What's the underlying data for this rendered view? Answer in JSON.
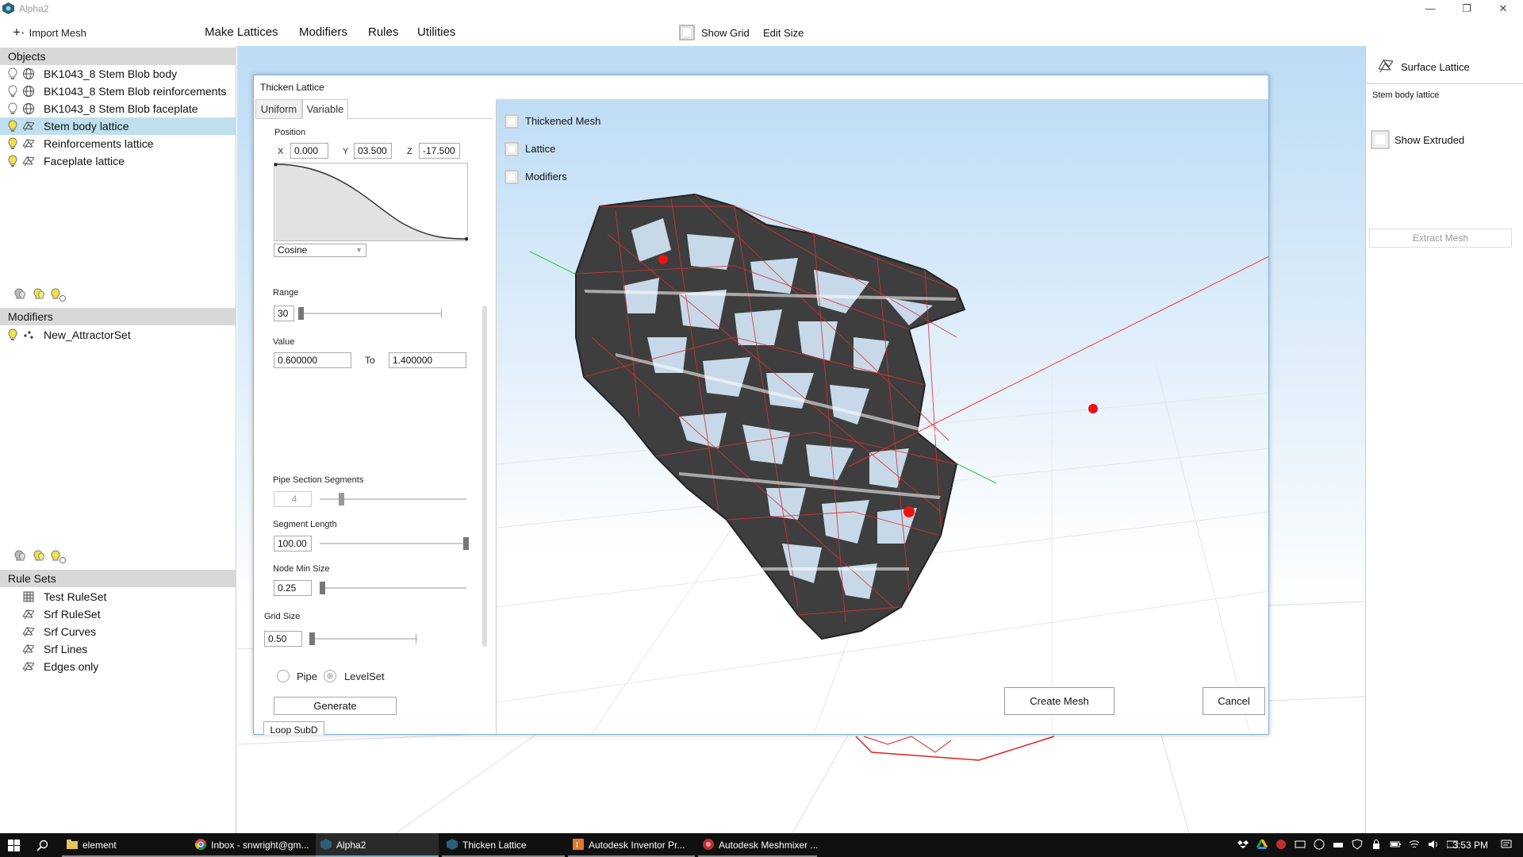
{
  "window": {
    "title": "Alpha2",
    "minimize": "—",
    "restore": "❐",
    "close": "✕"
  },
  "menubar": {
    "import_label": "Import Mesh",
    "menus": [
      "Make Lattices",
      "Modifiers",
      "Rules",
      "Utilities"
    ],
    "show_grid_label": "Show Grid",
    "edit_size_label": "Edit Size"
  },
  "objects": {
    "header": "Objects",
    "items": [
      {
        "label": "BK1043_8 Stem Blob body",
        "icon": "mesh-icon"
      },
      {
        "label": "BK1043_8 Stem Blob reinforcements",
        "icon": "mesh-icon"
      },
      {
        "label": "BK1043_8 Stem Blob faceplate",
        "icon": "mesh-icon"
      },
      {
        "label": "Stem body lattice",
        "icon": "lattice-icon"
      },
      {
        "label": "Reinforcements lattice",
        "icon": "lattice-icon"
      },
      {
        "label": "Faceplate lattice",
        "icon": "lattice-icon"
      }
    ]
  },
  "modifiers": {
    "header": "Modifiers",
    "items": [
      {
        "label": "New_AttractorSet",
        "icon": "attractor-icon"
      }
    ]
  },
  "rulesets": {
    "header": "Rule Sets",
    "items": [
      {
        "label": "Test RuleSet"
      },
      {
        "label": "Srf RuleSet"
      },
      {
        "label": "Srf Curves"
      },
      {
        "label": "Srf Lines"
      },
      {
        "label": "Edges only"
      }
    ]
  },
  "right_panel": {
    "title": "Surface Lattice",
    "subtitle": "Stem body lattice",
    "show_extruded_label": "Show Extruded",
    "extract_label": "Extract Mesh"
  },
  "dialog": {
    "title": "Thicken Lattice",
    "tabs": [
      "Uniform",
      "Variable"
    ],
    "position_label": "Position",
    "x_label": "X",
    "x_value": "0.000",
    "y_label": "Y",
    "y_value": "03.500",
    "z_label": "Z",
    "z_value": "-17.500",
    "falloff_value": "Cosine",
    "range_label": "Range",
    "range_value": "30",
    "value_label": "Value",
    "value_from": "0.600000",
    "to_label": "To",
    "value_to": "1.400000",
    "pipe_segments_label": "Pipe Section Segments",
    "pipe_segments_value": "4",
    "segment_length_label": "Segment Length",
    "segment_length_value": "100.00",
    "node_min_label": "Node Min Size",
    "node_min_value": "0.25",
    "grid_size_label": "Grid Size",
    "grid_size_value": "0.50",
    "pipe_label": "Pipe",
    "levelset_label": "LevelSet",
    "generate_label": "Generate",
    "loop_subd_label": "Loop SubD",
    "view_checks": [
      "Thickened Mesh",
      "Lattice",
      "Modifiers"
    ],
    "create_mesh_label": "Create Mesh",
    "cancel_label": "Cancel"
  },
  "taskbar": {
    "items": [
      {
        "label": "element",
        "icon": "folder-icon"
      },
      {
        "label": "Inbox - snwright@gm...",
        "icon": "chrome-icon"
      },
      {
        "label": "Alpha2",
        "icon": "app-icon"
      },
      {
        "label": "Thicken Lattice",
        "icon": "app-icon"
      },
      {
        "label": "Autodesk Inventor Pr...",
        "icon": "inventor-icon"
      },
      {
        "label": "Autodesk Meshmixer ...",
        "icon": "meshmixer-icon"
      }
    ],
    "clock": "3:53 PM"
  },
  "colors": {
    "selection": "#bfe0ee",
    "accent": "#7fb1d9",
    "lattice": "#444444",
    "wire": "#e02020"
  }
}
